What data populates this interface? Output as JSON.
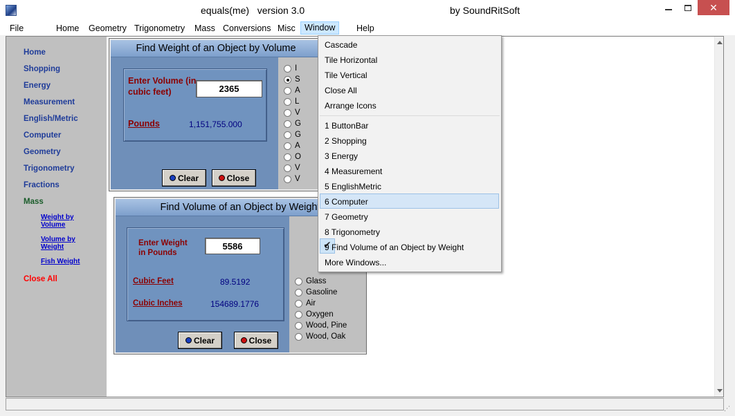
{
  "titlebar": {
    "title": "equals(me)   version 3.0",
    "company": "by SoundRitSoft",
    "close_glyph": "✕"
  },
  "menubar": {
    "items": [
      "File",
      "Home",
      "Geometry",
      "Trigonometry",
      "Mass",
      "Conversions",
      "Misc",
      "Window",
      "Help"
    ]
  },
  "sidebar": {
    "items": [
      "Home",
      "Shopping",
      "Energy",
      "Measurement",
      "English/Metric",
      "Computer",
      "Geometry",
      "Trigonometry",
      "Fractions",
      "Mass"
    ],
    "sub_items": [
      "Weight by Volume",
      "Volume by Weight",
      "Fish Weight"
    ],
    "close_all": "Close All"
  },
  "weight_window": {
    "title": "Find Weight of an Object by Volume",
    "input_label": "Enter Volume (in cubic feet)",
    "input_value": "2365",
    "result_label": "Pounds",
    "result_value": "1,151,755.000",
    "clear_label": "Clear",
    "close_label": "Close",
    "radio_letters": [
      "I",
      "S",
      "A",
      "L",
      "V",
      "G",
      "G",
      "A",
      "O",
      "V",
      "V"
    ],
    "selected_index": 1
  },
  "volume_window": {
    "title": "Find Volume of an Object by Weight",
    "input_label": "Enter Weight in Pounds",
    "input_value": "5586",
    "result1_label": "Cubic Feet",
    "result1_value": "89.5192",
    "result2_label": "Cubic Inches",
    "result2_value": "154689.1776",
    "clear_label": "Clear",
    "close_label": "Close",
    "radio_options": [
      "Glass",
      "Gasoline",
      "Air",
      "Oxygen",
      "Wood, Pine",
      "Wood, Oak"
    ]
  },
  "window_menu": {
    "items": [
      "Cascade",
      "Tile Horizontal",
      "Tile Vertical",
      "Close All",
      "Arrange Icons"
    ],
    "windows": [
      "1 ButtonBar",
      "2 Shopping",
      "3 Energy",
      "4 Measurement",
      "5 EnglishMetric",
      "6 Computer",
      "7 Geometry",
      "8 Trigonometry",
      "9 Find Volume of an Object by Weight"
    ],
    "more": "More Windows...",
    "check_glyph": "✔",
    "highlighted": "6 Computer"
  },
  "colors": {
    "title_gradient_top": "#a9c3e4",
    "panel_blue": "#7093bf",
    "label_red": "#8b0000",
    "value_navy": "#000080",
    "sidebar_link": "#1f3c99",
    "close_all": "#ff0000",
    "menu_highlight": "#cce8ff"
  }
}
